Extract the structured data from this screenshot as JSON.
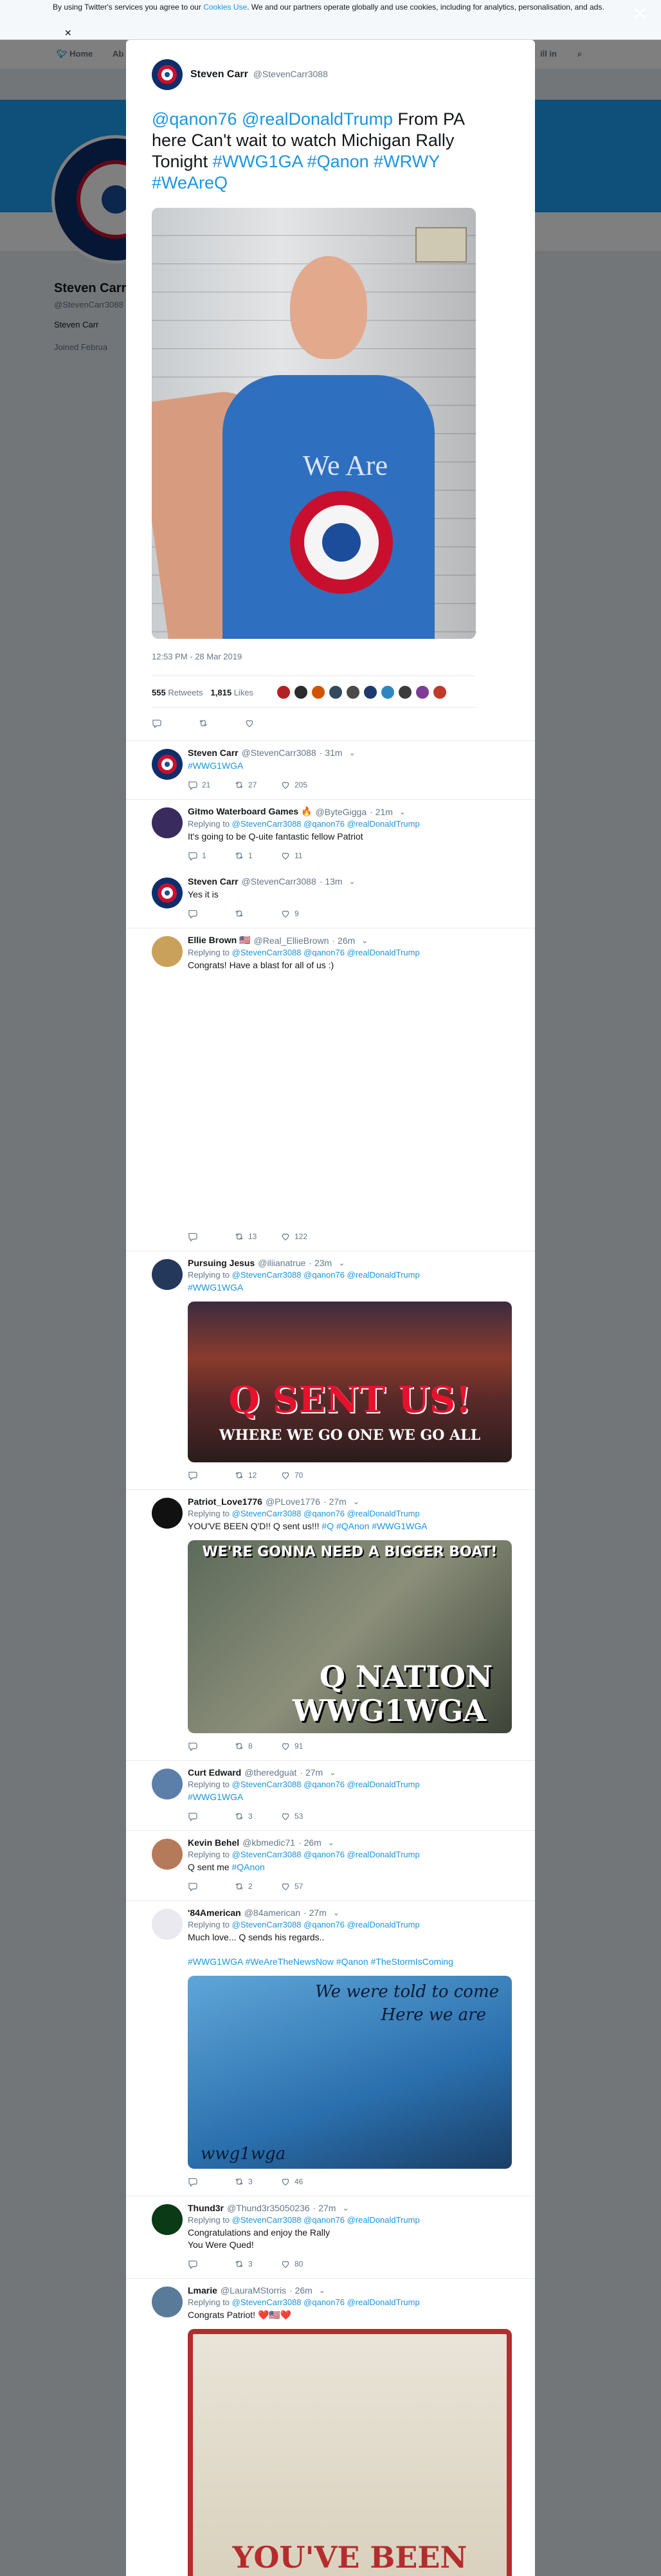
{
  "cookie": {
    "text_before": "By using Twitter's services you agree to our ",
    "link": "Cookies Use",
    "text_after": ". We and our partners operate globally and use cookies, including for analytics, personalisation, and ads."
  },
  "bg": {
    "nav": [
      "Home",
      "Ab"
    ],
    "nav_right": "ill in",
    "name": "Steven Carr",
    "handle": "@StevenCarr3088",
    "bio": "Steven Carr",
    "joined": "Joined Februa"
  },
  "main": {
    "name": "Steven Carr",
    "handle": "@StevenCarr3088",
    "text_mentions": "@qanon76  @realDonaldTrump",
    "text_body": "  From PA here Can't wait to watch Michigan Rally Tonight ",
    "hashtags": "#WWG1GA #Qanon #WRWY #WeAreQ",
    "shirt_text": "We Are",
    "timestamp": "12:53 PM - 28 Mar 2019",
    "retweets": "555",
    "retweets_label": "Retweets",
    "likes": "1,815",
    "likes_label": "Likes",
    "liker_colors": [
      "#b22222",
      "#2c2c2c",
      "#d35400",
      "#34495e",
      "#4a4a4a",
      "#1e3a6e",
      "#2e86c1",
      "#3b3b3b",
      "#7d3c98",
      "#c0392b"
    ]
  },
  "replies": [
    {
      "name": "Steven Carr",
      "handle": "@StevenCarr3088",
      "time": "· 31m",
      "replying": "",
      "text": "#WWG1WGA",
      "text_is_link": true,
      "reply_count": "21",
      "retweet_count": "27",
      "like_count": "205"
    },
    {
      "name": "Gitmo Waterboard Games 🔥",
      "handle": "@ByteGigga",
      "time": "· 21m",
      "replying_prefix": "Replying to",
      "replying": "@StevenCarr3088 @qanon76 @realDonaldTrump",
      "text": "It's going to be Q-uite fantastic fellow Patriot",
      "reply_count": "1",
      "retweet_count": "1",
      "like_count": "11"
    },
    {
      "name": "Steven Carr",
      "handle": "@StevenCarr3088",
      "time": "· 13m",
      "replying": "",
      "text": "Yes it is",
      "reply_count": "",
      "retweet_count": "",
      "like_count": "9"
    },
    {
      "name": "Ellie Brown 🇺🇸",
      "handle": "@Real_EllieBrown",
      "time": "· 26m",
      "replying_prefix": "Replying to",
      "replying": "@StevenCarr3088 @qanon76 @realDonaldTrump",
      "text": "Congrats! Have a blast for all of us :)",
      "reply_count": "",
      "retweet_count": "13",
      "like_count": "122"
    },
    {
      "name": "Pursuing Jesus",
      "handle": "@iliianatrue",
      "time": "· 23m",
      "replying_prefix": "Replying to",
      "replying": "@StevenCarr3088 @qanon76 @realDonaldTrump",
      "text": "#WWG1WGA",
      "text_is_link": true,
      "image_title": "Q SENT US!",
      "image_sub": "WHERE WE GO ONE WE GO ALL",
      "reply_count": "",
      "retweet_count": "12",
      "like_count": "70"
    },
    {
      "name": "Patriot_Love1776",
      "handle": "@PLove1776",
      "time": "· 27m",
      "replying_prefix": "Replying to",
      "replying": "@StevenCarr3088 @qanon76 @realDonaldTrump",
      "text": "YOU'VE BEEN Q'D!! Q sent us!!! ",
      "text_tags": "#Q #QAnon #WWG1WGA",
      "image_top": "WE'RE GONNA NEED A BIGGER BOAT!",
      "image_mid": "Q NATION",
      "image_bot": "WWG1WGA",
      "reply_count": "",
      "retweet_count": "8",
      "like_count": "91"
    },
    {
      "name": "Curt Edward",
      "handle": "@theredguat",
      "time": "· 27m",
      "replying_prefix": "Replying to",
      "replying": "@StevenCarr3088 @qanon76 @realDonaldTrump",
      "text": "#WWG1WGA",
      "text_is_link": true,
      "reply_count": "",
      "retweet_count": "3",
      "like_count": "53"
    },
    {
      "name": "Kevin Behel",
      "handle": "@kbmedic71",
      "time": "· 26m",
      "replying_prefix": "Replying to",
      "replying": "@StevenCarr3088 @qanon76 @realDonaldTrump",
      "text": "Q sent me ",
      "text_tags": "#QAnon",
      "reply_count": "",
      "retweet_count": "2",
      "like_count": "57"
    },
    {
      "name": "'84American",
      "handle": "@84american",
      "time": "· 27m",
      "replying_prefix": "Replying to",
      "replying": "@StevenCarr3088 @qanon76 @realDonaldTrump",
      "text": "Much love... Q sends his regards..",
      "text_tags": "#WWG1WGA #WeAreTheNewsNow #Qanon #TheStormIsComing",
      "image_top": "We were told to come",
      "image_mid": "Here we are",
      "image_bot": "wwg1wga",
      "reply_count": "",
      "retweet_count": "3",
      "like_count": "46"
    },
    {
      "name": "Thund3r",
      "handle": "@Thund3r35050236",
      "time": "· 27m",
      "replying_prefix": "Replying to",
      "replying": "@StevenCarr3088 @qanon76 @realDonaldTrump",
      "text": "Congratulations and enjoy the Rally\nYou Were Qued!",
      "reply_count": "",
      "retweet_count": "3",
      "like_count": "80"
    },
    {
      "name": "Lmarie",
      "handle": "@LauraMStorris",
      "time": "· 26m",
      "replying_prefix": "Replying to",
      "replying": "@StevenCarr3088 @qanon76 @realDonaldTrump",
      "text": "Congrats Patriot! ❤️🇺🇸❤️",
      "image_bot": "YOU'VE BEEN",
      "reply_count": "",
      "retweet_count": "",
      "like_count": ""
    }
  ]
}
